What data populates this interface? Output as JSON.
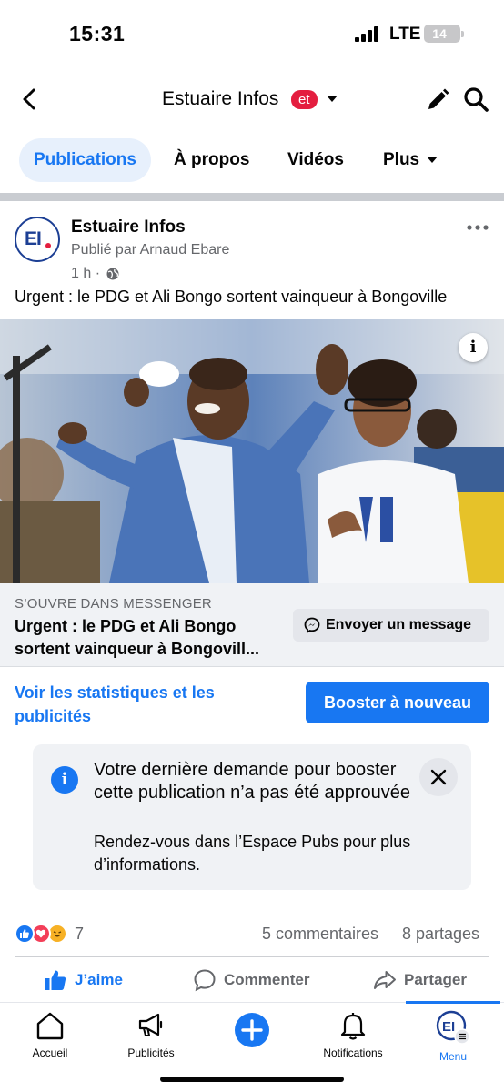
{
  "status_bar": {
    "time": "15:31",
    "network": "LTE",
    "battery": "14"
  },
  "header": {
    "title": "Estuaire Infos",
    "badge": "et"
  },
  "tabs": [
    {
      "label": "Publications",
      "active": true
    },
    {
      "label": "À propos",
      "active": false
    },
    {
      "label": "Vidéos",
      "active": false
    },
    {
      "label": "Plus",
      "active": false
    }
  ],
  "post": {
    "avatar_letters": "EI",
    "author": "Estuaire Infos",
    "published_by": "Publié par Arnaud Ebare",
    "time": "1 h ·",
    "text": "Urgent : le PDG et Ali Bongo sortent vainqueur à Bongoville",
    "info_label": "i",
    "link_card": {
      "source": "S’OUVRE DANS MESSENGER",
      "title": "Urgent : le PDG et Ali Bongo sortent vainqueur à Bongovill...",
      "button": "Envoyer un message"
    },
    "stats_link": "Voir les statistiques et les publicités",
    "boost_button": "Booster à nouveau",
    "notice": {
      "title": "Votre dernière demande pour booster cette publication n’a pas été approuvée",
      "body": "Rendez-vous dans l’Espace Pubs pour plus d’informations."
    },
    "reactions": {
      "count": "7",
      "types": [
        "like",
        "love",
        "haha"
      ]
    },
    "comments": "5 commentaires",
    "shares": "8 partages",
    "actions": {
      "like": "J’aime",
      "comment": "Commenter",
      "share": "Partager"
    }
  },
  "bottom_nav": [
    {
      "label": "Accueil",
      "icon": "home-icon"
    },
    {
      "label": "Publicités",
      "icon": "megaphone-icon"
    },
    {
      "label": "",
      "icon": "create-plus-icon"
    },
    {
      "label": "Notifications",
      "icon": "bell-icon"
    },
    {
      "label": "Menu",
      "icon": "profile-menu-icon",
      "active": true
    }
  ],
  "colors": {
    "accent": "#1877f2",
    "badge": "#e41e3f",
    "muted": "#65676b"
  }
}
